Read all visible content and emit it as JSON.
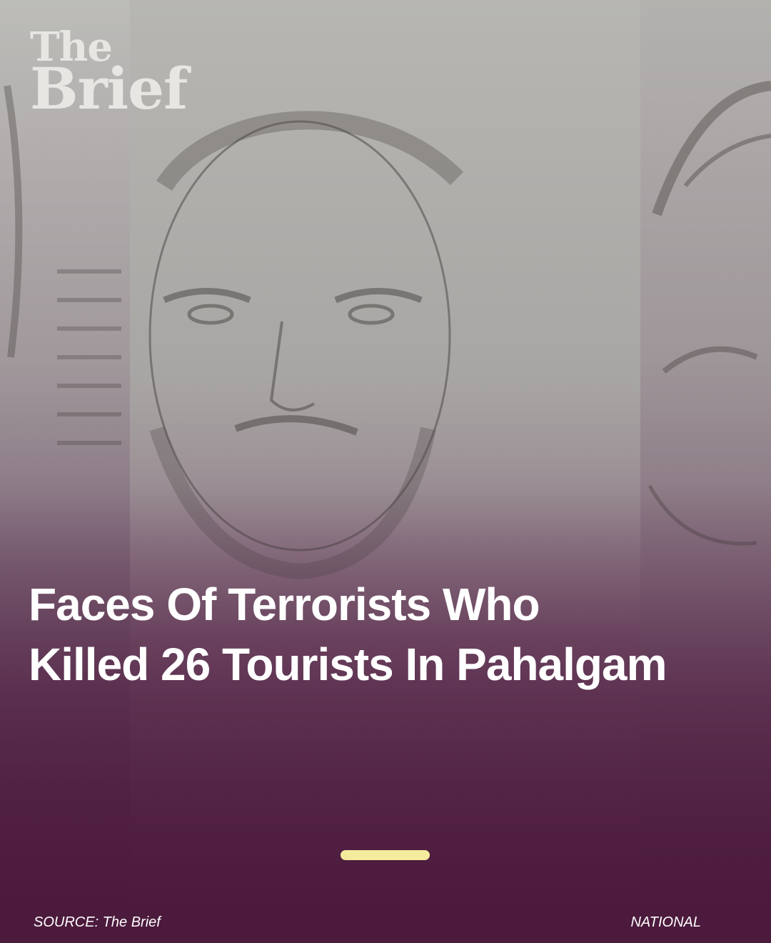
{
  "brand": {
    "line1": "The",
    "line2": "Brief"
  },
  "story": {
    "headline": "Faces Of Terrorists Who Killed 26 Tourists In Pahalgam",
    "source": "SOURCE: The Brief",
    "category": "NATIONAL"
  },
  "pager": {
    "active_index": 0
  },
  "colors": {
    "overlay": "#4c1a3c",
    "indicator": "#f4eb9c",
    "text": "#ffffff",
    "logo": "#e8e6e2"
  }
}
